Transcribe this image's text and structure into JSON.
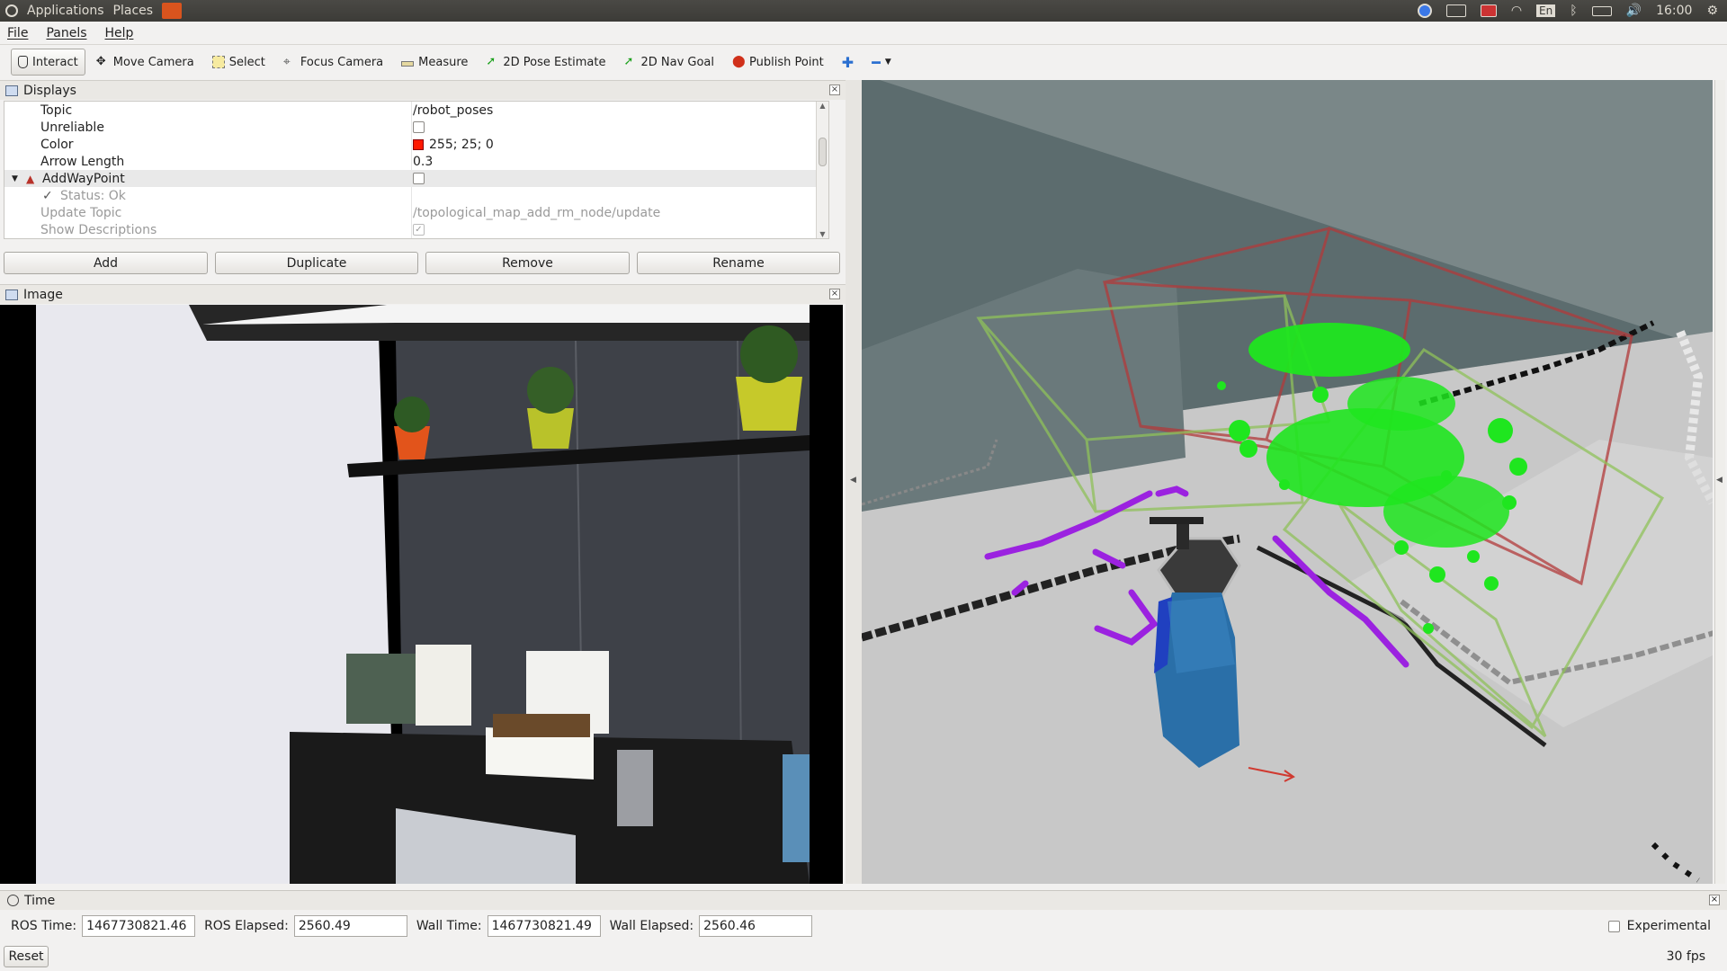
{
  "top_panel": {
    "applications": "Applications",
    "places": "Places",
    "keyboard_layout": "En",
    "clock": "16:00"
  },
  "menu": {
    "file": "File",
    "panels": "Panels",
    "help": "Help"
  },
  "toolbar": {
    "interact": "Interact",
    "move_camera": "Move Camera",
    "select": "Select",
    "focus_camera": "Focus Camera",
    "measure": "Measure",
    "pose_estimate": "2D Pose Estimate",
    "nav_goal": "2D Nav Goal",
    "publish_point": "Publish Point"
  },
  "displays": {
    "title": "Displays",
    "rows": [
      {
        "key": "Topic",
        "value": "/robot_poses"
      },
      {
        "key": "Unreliable",
        "value": ""
      },
      {
        "key": "Color",
        "value": "255; 25; 0"
      },
      {
        "key": "Arrow Length",
        "value": "0.3"
      },
      {
        "key": "AddWayPoint",
        "value": ""
      },
      {
        "key": "Status: Ok",
        "value": ""
      },
      {
        "key": "Update Topic",
        "value": "/topological_map_add_rm_node/update"
      },
      {
        "key": "Show Descriptions",
        "value": ""
      }
    ],
    "color_swatch": "#ff1900",
    "buttons": {
      "add": "Add",
      "duplicate": "Duplicate",
      "remove": "Remove",
      "rename": "Rename"
    }
  },
  "image_panel": {
    "title": "Image"
  },
  "time_panel": {
    "title": "Time",
    "ros_time_label": "ROS Time:",
    "ros_time": "1467730821.46",
    "ros_elapsed_label": "ROS Elapsed:",
    "ros_elapsed": "2560.49",
    "wall_time_label": "Wall Time:",
    "wall_time": "1467730821.49",
    "wall_elapsed_label": "Wall Elapsed:",
    "wall_elapsed": "2560.46",
    "experimental": "Experimental"
  },
  "status": {
    "reset": "Reset",
    "fps": "30 fps"
  }
}
